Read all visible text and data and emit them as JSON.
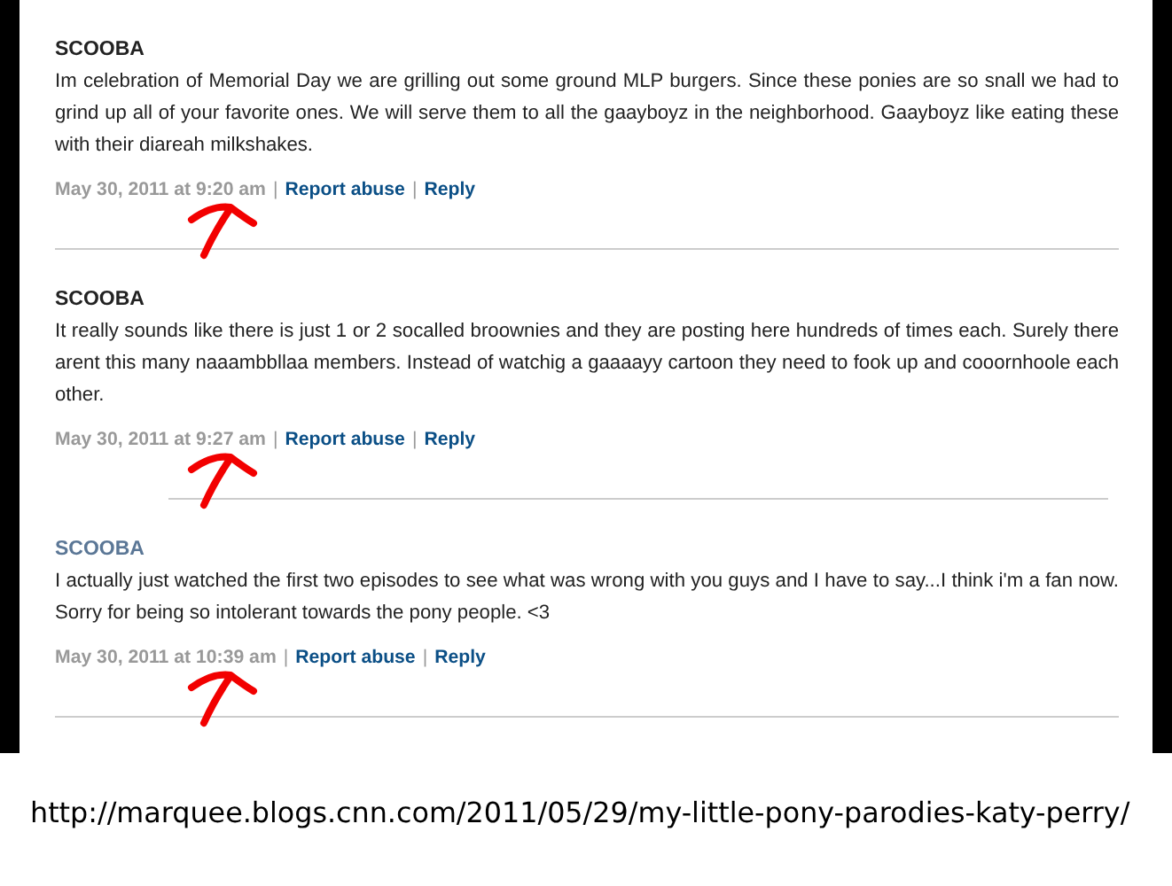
{
  "comments": [
    {
      "author": "SCOOBA",
      "author_linked": false,
      "body": "Im celebration of Memorial Day we are grilling out some ground MLP burgers. Since these ponies are so snall we had to grind up all of your favorite ones. We will serve them to all the gaayboyz in the neighborhood. Gaayboyz like eating these with their diareah milkshakes.",
      "timestamp": "May 30, 2011 at 9:20 am",
      "separator_1": "|",
      "report": "Report abuse",
      "separator_2": "|",
      "reply": "Reply",
      "annotated": true,
      "divider_indented": false
    },
    {
      "author": "SCOOBA",
      "author_linked": false,
      "body": "It really sounds like there is just 1 or 2 socalled broownies and they are posting here hundreds of times each. Surely there arent this many naaambbllaa members. Instead of watchig a gaaaayy cartoon they need to fook up and cooornhoole each other.",
      "timestamp": "May 30, 2011 at 9:27 am",
      "separator_1": "|",
      "report": "Report abuse",
      "separator_2": "|",
      "reply": "Reply",
      "annotated": true,
      "divider_indented": true
    },
    {
      "author": "SCOOBA",
      "author_linked": true,
      "body": "I actually just watched the first two episodes to see what was wrong with you guys and I have to say...I think i'm a fan now. Sorry for being so intolerant towards the pony people. <3",
      "timestamp": "May 30, 2011 at 10:39 am",
      "separator_1": "|",
      "report": "Report abuse",
      "separator_2": "|",
      "reply": "Reply",
      "annotated": true,
      "divider_indented": false
    }
  ],
  "source_url": "http://marquee.blogs.cnn.com/2011/05/29/my-little-pony-parodies-katy-perry/"
}
